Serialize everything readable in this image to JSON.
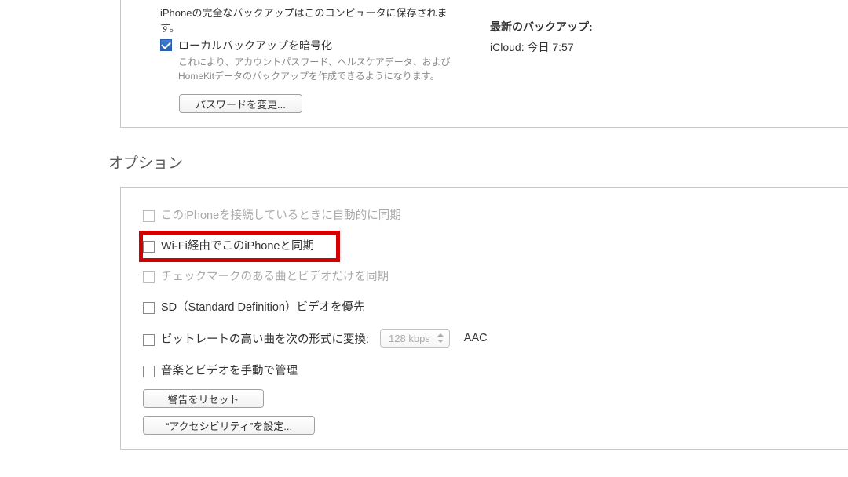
{
  "backup": {
    "desc_top": "iPhoneの完全なバックアップはこのコンピュータに保存されます。",
    "encrypt_label": "ローカルバックアップを暗号化",
    "encrypt_desc": "これにより、アカウントパスワード、ヘルスケアデータ、およびHomeKitデータのバックアップを作成できるようになります。",
    "change_password_btn": "パスワードを変更...",
    "latest_backup_title": "最新のバックアップ:",
    "latest_backup_value": "iCloud: 今日 7:57"
  },
  "options": {
    "section_title": "オプション",
    "auto_sync": "このiPhoneを接続しているときに自動的に同期",
    "wifi_sync": "Wi-Fi経由でこのiPhoneと同期",
    "checked_only": "チェックマークのある曲とビデオだけを同期",
    "sd_pref": "SD（Standard Definition）ビデオを優先",
    "bitrate_label": "ビットレートの高い曲を次の形式に変換:",
    "bitrate_value": "128 kbps",
    "bitrate_codec": "AAC",
    "manual_manage": "音楽とビデオを手動で管理",
    "reset_warnings_btn": "警告をリセット",
    "accessibility_btn": "“アクセシビリティ”を設定..."
  }
}
